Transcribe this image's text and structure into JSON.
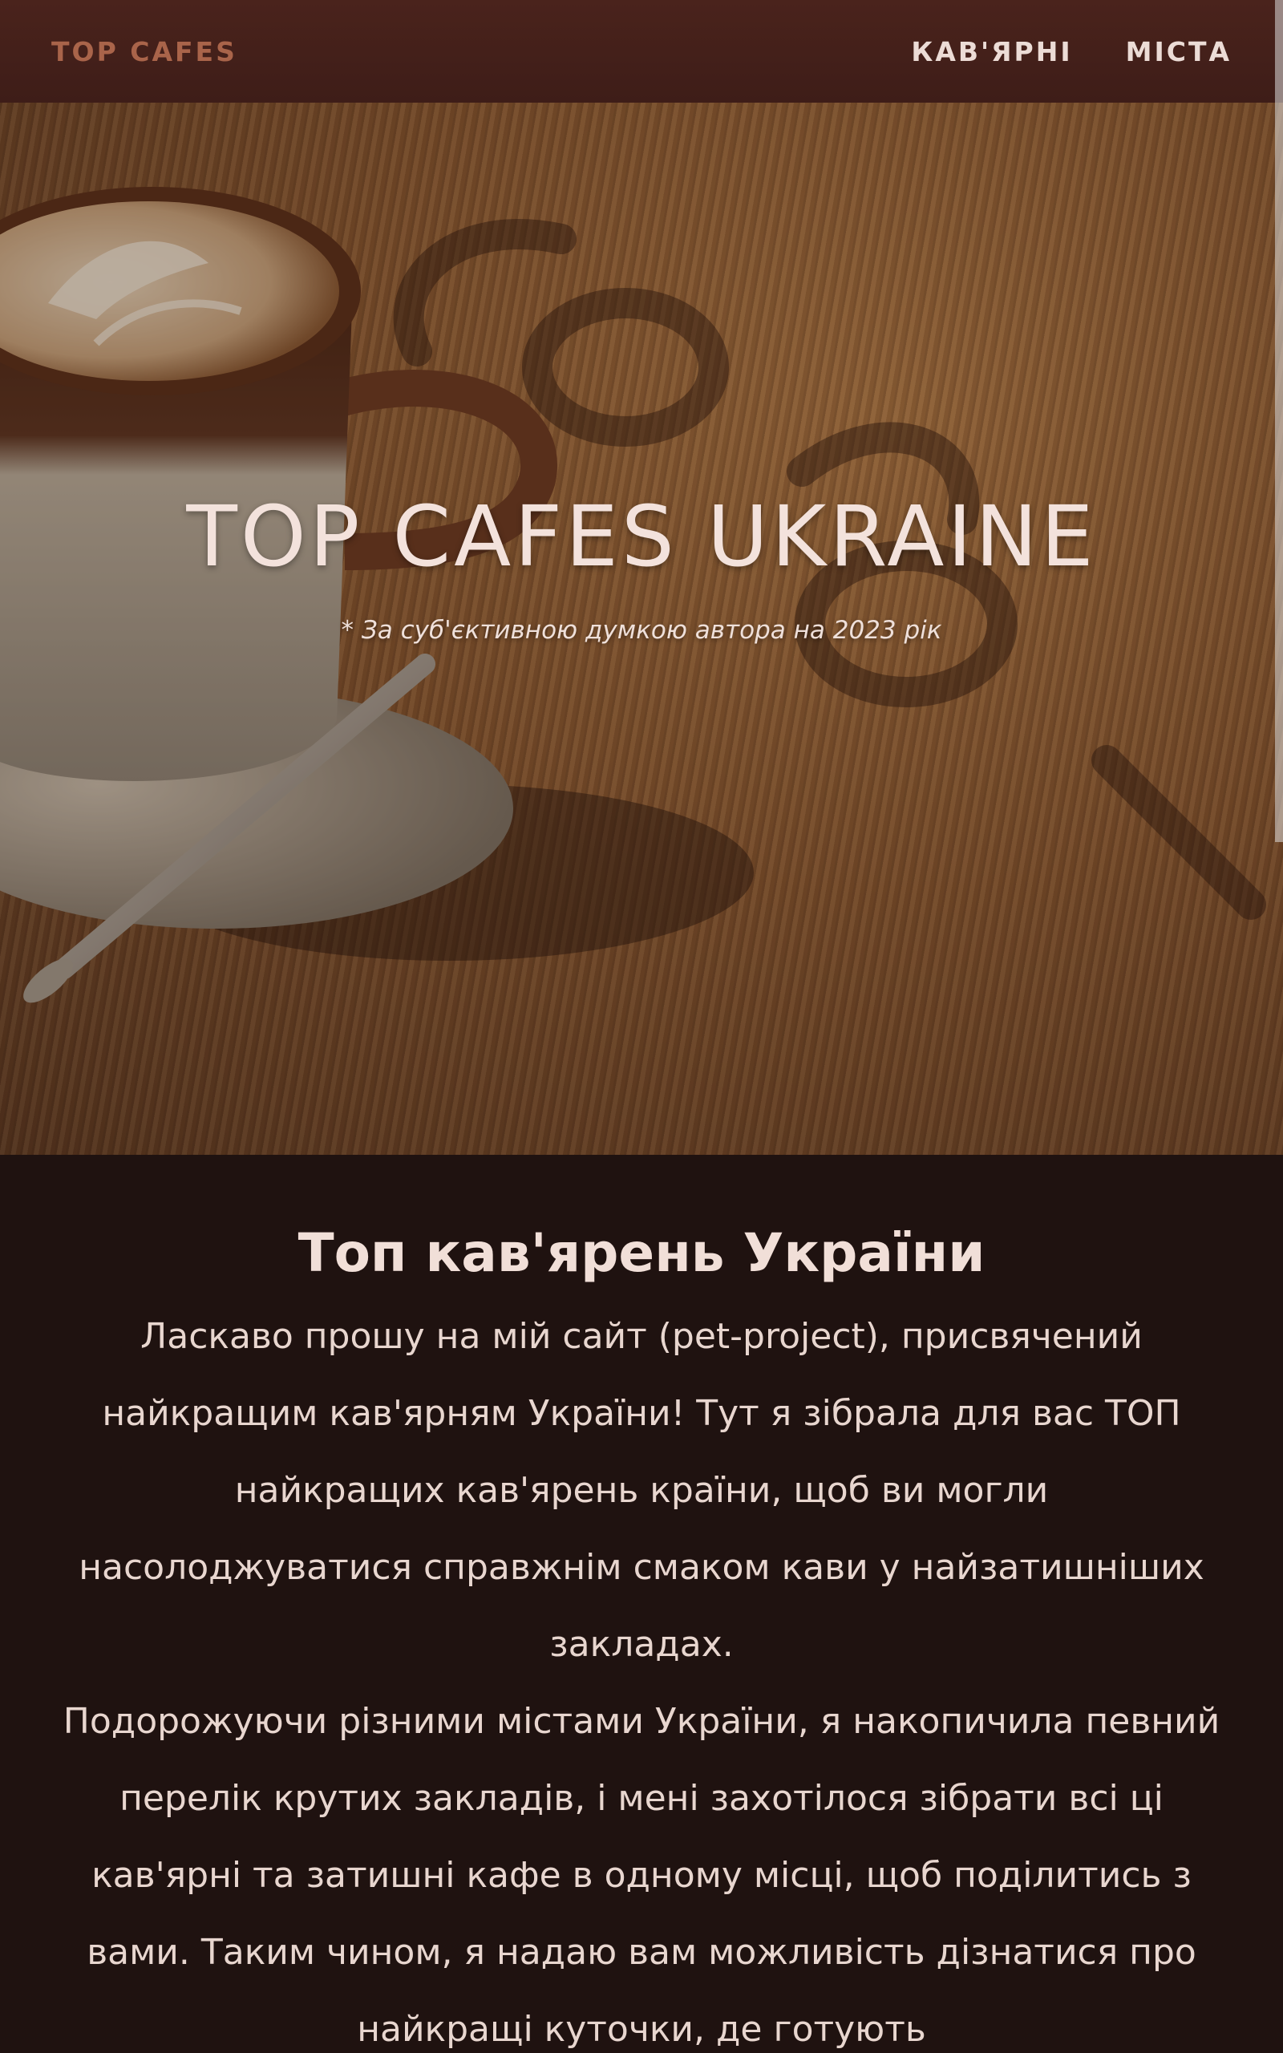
{
  "navbar": {
    "brand": "TOP CAFES",
    "links": [
      "КАВ'ЯРНІ",
      "МІСТА"
    ]
  },
  "hero": {
    "title": "TOP CAFES UKRAINE",
    "subtitle": "* За суб'єктивною думкою автора на 2023 рік"
  },
  "content": {
    "title": "Топ кав'ярень України",
    "paragraphs": [
      "Ласкаво прошу на мій сайт (pet-project), присвячений найкращим кав'ярням України! Тут я зібрала для вас ТОП найкращих кав'ярень країни, щоб ви могли насолоджуватися справжнім смаком кави у найзатишніших закладах.",
      "Подорожуючи різними містами України, я накопичила певний перелік крутих закладів, і мені захотілося зібрати всі ці кав'ярні та затишні кафе в одному місці, щоб поділитись з вами. Таким чином, я надаю вам можливість дізнатися про найкращі куточки, де готують"
    ]
  },
  "colors": {
    "navbar": "#4a231c",
    "brand": "#a9644a",
    "content_bg": "#1f1210",
    "text": "#e8d6cf"
  }
}
